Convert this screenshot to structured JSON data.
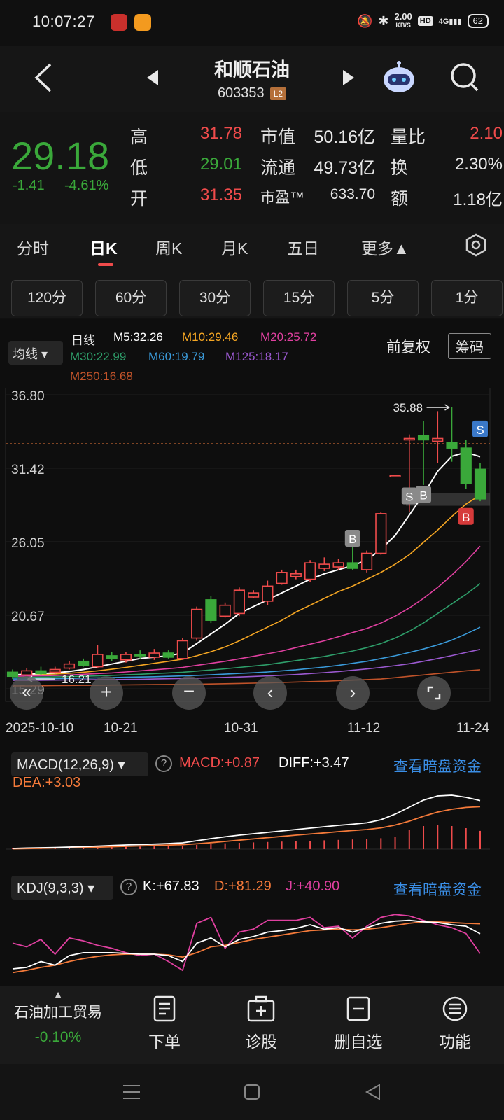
{
  "status_bar": {
    "time": "10:07:27",
    "net_speed": "2.00",
    "net_unit": "KB/S",
    "hd": "HD",
    "signal": "4G",
    "battery": "62"
  },
  "header": {
    "title": "和顺石油",
    "code": "603353",
    "level_badge": "L2"
  },
  "quote": {
    "price": "29.18",
    "change": "-1.41",
    "change_pct": "-4.61%",
    "rows": [
      {
        "l1": "高",
        "v1": "31.78",
        "l2": "市值",
        "v2": "50.16亿",
        "l3": "量比",
        "v3": "2.10"
      },
      {
        "l1": "低",
        "v1": "29.01",
        "l2": "流通",
        "v2": "49.73亿",
        "l3": "换",
        "v3": "2.30%"
      },
      {
        "l1": "开",
        "v1": "31.35",
        "l2": "市盈™",
        "v2": "633.70",
        "l3": "额",
        "v3": "1.18亿"
      }
    ]
  },
  "period_tabs": [
    "分时",
    "日K",
    "周K",
    "月K",
    "五日",
    "更多▲"
  ],
  "active_period": "日K",
  "minute_buttons": [
    "120分",
    "60分",
    "30分",
    "15分",
    "5分",
    "1分"
  ],
  "ma": {
    "toggle": "均线",
    "label": "日线",
    "m5": "M5:32.26",
    "m10": "M10:29.46",
    "m20": "M20:25.72",
    "m30": "M30:22.99",
    "m60": "M60:19.79",
    "m125": "M125:18.17",
    "m250": "M250:16.68",
    "adjust": "前复权",
    "chips": "筹码"
  },
  "colors": {
    "up": "#ef4b4b",
    "down": "#3aa83a",
    "m5": "#ffffff",
    "m10": "#f5a623",
    "m20": "#e040a0",
    "m30": "#2e9e6a",
    "m60": "#3a9ad9",
    "m125": "#9b59d0",
    "m250": "#c0532a"
  },
  "chart_data": {
    "type": "candlestick",
    "y_ticks": [
      "36.80",
      "31.42",
      "26.05",
      "20.67",
      "15.29"
    ],
    "ylim": [
      15.29,
      36.8
    ],
    "x_labels": [
      "2025-10-10",
      "10-21",
      "10-31",
      "11-12",
      "11-24"
    ],
    "max_label": "35.88",
    "min_label": "16.21",
    "candles": [
      {
        "o": 16.5,
        "c": 16.2,
        "h": 16.7,
        "l": 16.0
      },
      {
        "o": 16.3,
        "c": 16.6,
        "h": 16.8,
        "l": 16.2
      },
      {
        "o": 16.6,
        "c": 16.4,
        "h": 16.9,
        "l": 16.3
      },
      {
        "o": 16.5,
        "c": 16.7,
        "h": 16.9,
        "l": 16.4
      },
      {
        "o": 16.8,
        "c": 17.1,
        "h": 17.3,
        "l": 16.7
      },
      {
        "o": 17.3,
        "c": 17.0,
        "h": 17.5,
        "l": 16.9
      },
      {
        "o": 16.9,
        "c": 17.8,
        "h": 18.5,
        "l": 16.8
      },
      {
        "o": 17.7,
        "c": 17.5,
        "h": 18.0,
        "l": 17.3
      },
      {
        "o": 17.4,
        "c": 17.8,
        "h": 18.0,
        "l": 17.2
      },
      {
        "o": 17.8,
        "c": 17.7,
        "h": 18.1,
        "l": 17.5
      },
      {
        "o": 17.6,
        "c": 17.9,
        "h": 18.2,
        "l": 17.4
      },
      {
        "o": 17.9,
        "c": 17.6,
        "h": 18.1,
        "l": 17.5
      },
      {
        "o": 17.5,
        "c": 18.8,
        "h": 19.0,
        "l": 17.4
      },
      {
        "o": 19.0,
        "c": 21.1,
        "h": 21.3,
        "l": 18.8
      },
      {
        "o": 21.8,
        "c": 20.3,
        "h": 22.1,
        "l": 20.1
      },
      {
        "o": 20.6,
        "c": 21.4,
        "h": 21.6,
        "l": 20.5
      },
      {
        "o": 20.8,
        "c": 22.5,
        "h": 22.7,
        "l": 20.6
      },
      {
        "o": 22.0,
        "c": 22.3,
        "h": 22.5,
        "l": 21.9
      },
      {
        "o": 21.7,
        "c": 22.8,
        "h": 23.2,
        "l": 21.4
      },
      {
        "o": 23.0,
        "c": 23.8,
        "h": 24.0,
        "l": 22.9
      },
      {
        "o": 23.5,
        "c": 23.7,
        "h": 24.0,
        "l": 23.3
      },
      {
        "o": 23.3,
        "c": 24.5,
        "h": 24.7,
        "l": 23.1
      },
      {
        "o": 24.1,
        "c": 24.4,
        "h": 24.9,
        "l": 23.9
      },
      {
        "o": 24.2,
        "c": 24.5,
        "h": 24.8,
        "l": 24.0
      },
      {
        "o": 24.5,
        "c": 24.1,
        "h": 25.8,
        "l": 24.0
      },
      {
        "o": 24.0,
        "c": 25.2,
        "h": 25.4,
        "l": 23.8
      },
      {
        "o": 25.2,
        "c": 28.1,
        "h": 28.2,
        "l": 25.1
      },
      {
        "o": 30.9,
        "c": 30.9,
        "h": 30.9,
        "l": 30.9
      },
      {
        "o": 33.6,
        "c": 33.6,
        "h": 33.9,
        "l": 28.2
      },
      {
        "o": 33.8,
        "c": 33.5,
        "h": 34.9,
        "l": 30.2
      },
      {
        "o": 33.4,
        "c": 33.6,
        "h": 35.6,
        "l": 31.8
      },
      {
        "o": 33.3,
        "c": 32.9,
        "h": 35.9,
        "l": 31.9
      },
      {
        "o": 32.9,
        "c": 30.3,
        "h": 33.5,
        "l": 29.9
      },
      {
        "o": 31.35,
        "c": 29.18,
        "h": 31.78,
        "l": 29.01
      }
    ],
    "last_price": 33.2,
    "markers": [
      {
        "label": "B",
        "index": 24,
        "price": 26.3,
        "color": "gray"
      },
      {
        "label": "S",
        "index": 28,
        "price": 29.4,
        "color": "gray"
      },
      {
        "label": "B",
        "index": 29,
        "price": 29.5,
        "color": "gray"
      },
      {
        "label": "S",
        "index": 33,
        "price": 34.3,
        "color": "blue"
      },
      {
        "label": "B",
        "index": 32,
        "price": 27.9,
        "color": "red"
      }
    ],
    "ma_lines": {
      "m5": [
        16.3,
        16.35,
        16.4,
        16.45,
        16.55,
        16.7,
        16.9,
        17.1,
        17.3,
        17.5,
        17.6,
        17.7,
        17.9,
        18.6,
        19.3,
        20.0,
        20.8,
        21.3,
        21.8,
        22.3,
        22.8,
        23.3,
        23.7,
        24.0,
        24.3,
        24.7,
        25.5,
        26.5,
        28.0,
        29.5,
        31.2,
        32.3,
        32.6,
        32.26
      ],
      "m10": [
        16.3,
        16.32,
        16.34,
        16.37,
        16.42,
        16.5,
        16.6,
        16.72,
        16.85,
        17.0,
        17.15,
        17.3,
        17.45,
        17.7,
        18.0,
        18.35,
        18.8,
        19.3,
        19.8,
        20.3,
        20.9,
        21.4,
        21.9,
        22.4,
        22.8,
        23.3,
        23.8,
        24.4,
        25.1,
        26.0,
        26.9,
        27.9,
        28.8,
        29.46
      ],
      "m20": [
        16.2,
        16.22,
        16.24,
        16.26,
        16.3,
        16.35,
        16.4,
        16.45,
        16.52,
        16.6,
        16.68,
        16.76,
        16.85,
        17.0,
        17.15,
        17.3,
        17.48,
        17.66,
        17.85,
        18.05,
        18.3,
        18.55,
        18.8,
        19.1,
        19.4,
        19.7,
        20.1,
        20.6,
        21.2,
        21.9,
        22.7,
        23.6,
        24.6,
        25.72
      ],
      "m30": [
        16.1,
        16.12,
        16.14,
        16.16,
        16.18,
        16.2,
        16.23,
        16.27,
        16.31,
        16.35,
        16.4,
        16.45,
        16.5,
        16.58,
        16.66,
        16.75,
        16.85,
        16.95,
        17.05,
        17.2,
        17.35,
        17.5,
        17.65,
        17.85,
        18.05,
        18.3,
        18.6,
        19.0,
        19.5,
        20.1,
        20.8,
        21.5,
        22.2,
        22.99
      ],
      "m60": [
        16.0,
        16.0,
        16.02,
        16.03,
        16.05,
        16.07,
        16.09,
        16.11,
        16.13,
        16.15,
        16.17,
        16.2,
        16.23,
        16.27,
        16.31,
        16.36,
        16.41,
        16.46,
        16.52,
        16.6,
        16.68,
        16.78,
        16.88,
        17.0,
        17.15,
        17.3,
        17.5,
        17.7,
        17.95,
        18.2,
        18.5,
        18.85,
        19.3,
        19.79
      ],
      "m125": [
        15.9,
        15.9,
        15.91,
        15.92,
        15.93,
        15.94,
        15.95,
        15.96,
        15.97,
        15.98,
        16.0,
        16.02,
        16.04,
        16.06,
        16.09,
        16.12,
        16.15,
        16.19,
        16.23,
        16.28,
        16.33,
        16.4,
        16.47,
        16.55,
        16.64,
        16.74,
        16.85,
        16.98,
        17.12,
        17.3,
        17.5,
        17.72,
        17.95,
        18.17
      ],
      "m250": [
        15.5,
        15.5,
        15.51,
        15.52,
        15.53,
        15.54,
        15.55,
        15.56,
        15.57,
        15.58,
        15.59,
        15.6,
        15.61,
        15.62,
        15.64,
        15.66,
        15.68,
        15.7,
        15.72,
        15.75,
        15.78,
        15.81,
        15.84,
        15.88,
        15.92,
        15.96,
        16.0,
        16.1,
        16.2,
        16.3,
        16.4,
        16.5,
        16.6,
        16.68
      ]
    }
  },
  "macd": {
    "title": "MACD(12,26,9)",
    "macd": "MACD:+0.87",
    "diff": "DIFF:+3.47",
    "dea": "DEA:+3.03",
    "link": "查看暗盘资金",
    "hist": [
      0.05,
      0.06,
      0.07,
      0.07,
      0.08,
      0.09,
      0.1,
      0.11,
      0.12,
      0.12,
      0.13,
      0.14,
      0.15,
      0.2,
      0.25,
      0.28,
      0.3,
      0.32,
      0.34,
      0.36,
      0.38,
      0.4,
      0.42,
      0.44,
      0.46,
      0.48,
      0.52,
      0.6,
      0.9,
      1.1,
      1.15,
      1.1,
      1.0,
      0.87
    ],
    "diff_vals": [
      0.05,
      0.08,
      0.1,
      0.12,
      0.15,
      0.18,
      0.22,
      0.26,
      0.3,
      0.33,
      0.36,
      0.4,
      0.45,
      0.6,
      0.75,
      0.88,
      1.0,
      1.1,
      1.2,
      1.3,
      1.4,
      1.5,
      1.6,
      1.7,
      1.78,
      1.88,
      2.1,
      2.5,
      3.0,
      3.5,
      3.8,
      3.85,
      3.7,
      3.47
    ],
    "dea_vals": [
      0.02,
      0.04,
      0.06,
      0.08,
      0.1,
      0.12,
      0.14,
      0.17,
      0.2,
      0.23,
      0.26,
      0.29,
      0.32,
      0.38,
      0.46,
      0.55,
      0.64,
      0.73,
      0.82,
      0.91,
      1.0,
      1.08,
      1.16,
      1.25,
      1.33,
      1.4,
      1.52,
      1.72,
      2.0,
      2.35,
      2.65,
      2.85,
      2.98,
      3.03
    ]
  },
  "kdj": {
    "title": "KDJ(9,3,3)",
    "k": "K:+67.83",
    "d": "D:+81.29",
    "j": "J:+40.90",
    "link": "查看暗盘资金",
    "k_vals": [
      20,
      22,
      30,
      25,
      38,
      42,
      42,
      42,
      41,
      40,
      40,
      38,
      30,
      55,
      62,
      50,
      60,
      64,
      70,
      72,
      75,
      80,
      74,
      76,
      70,
      76,
      82,
      85,
      86,
      84,
      83,
      80,
      78,
      67.83
    ],
    "d_vals": [
      15,
      18,
      22,
      25,
      30,
      34,
      37,
      39,
      40,
      40,
      40,
      39,
      36,
      42,
      50,
      52,
      56,
      60,
      63,
      66,
      69,
      72,
      73,
      74,
      73,
      74,
      76,
      79,
      82,
      84,
      84,
      83,
      82,
      81.29
    ],
    "j_vals": [
      55,
      50,
      60,
      40,
      62,
      58,
      52,
      48,
      42,
      38,
      40,
      30,
      18,
      82,
      90,
      48,
      70,
      74,
      86,
      86,
      86,
      90,
      76,
      78,
      62,
      78,
      90,
      94,
      92,
      86,
      80,
      76,
      68,
      40.9
    ]
  },
  "sector": {
    "name": "石油加工贸易",
    "change": "-0.10%"
  },
  "bottom_nav": [
    "下单",
    "诊股",
    "删自选",
    "功能"
  ]
}
